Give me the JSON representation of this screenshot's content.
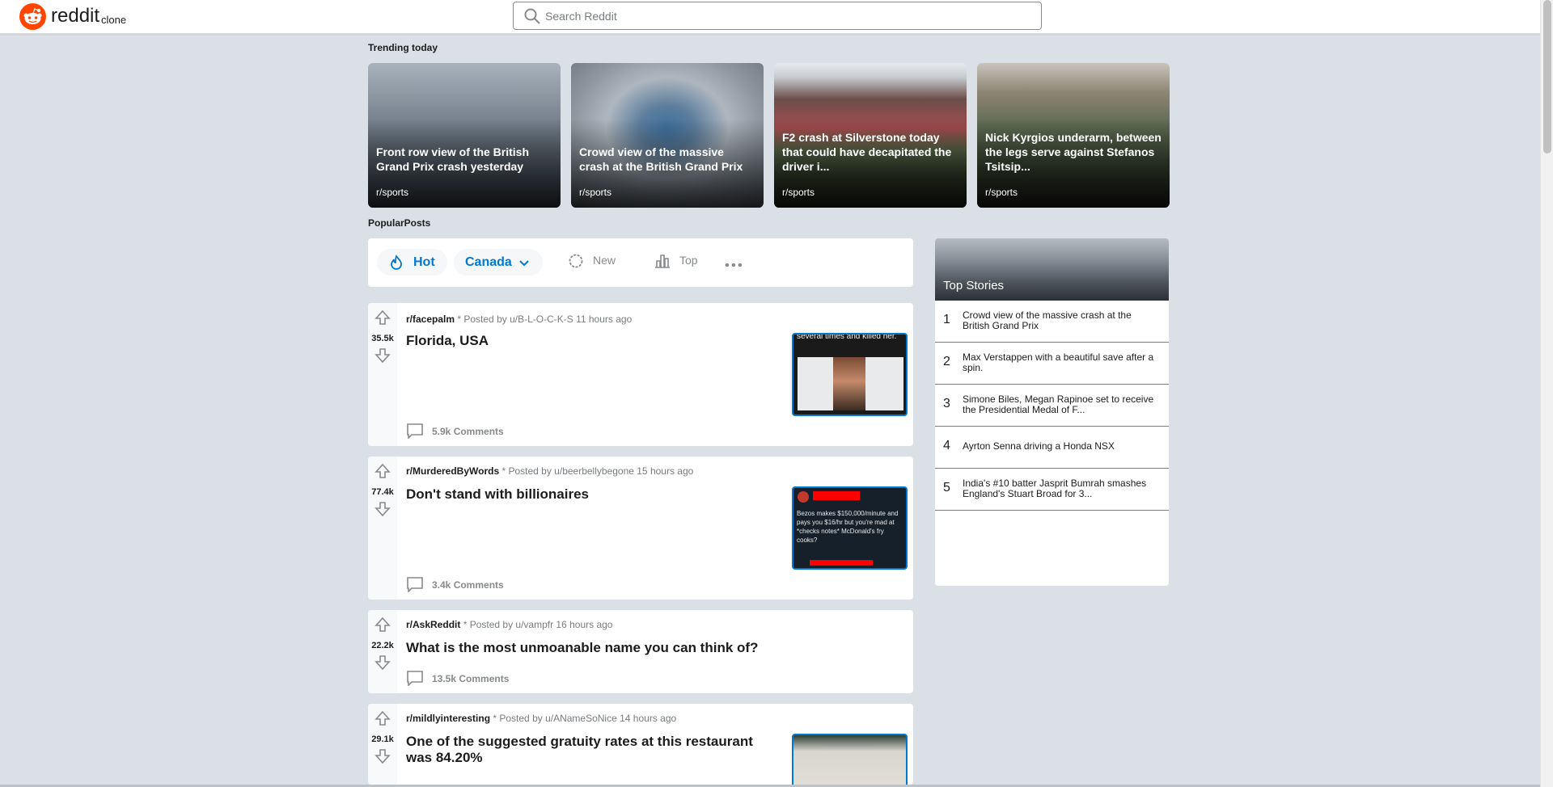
{
  "header": {
    "brand": "reddit",
    "brand_sub": "clone",
    "search_placeholder": "Search Reddit"
  },
  "trending": {
    "heading": "Trending today",
    "cards": [
      {
        "title": "Front row view of the British Grand Prix crash yesterday",
        "subreddit": "r/sports"
      },
      {
        "title": "Crowd view of the massive crash at the British Grand Prix",
        "subreddit": "r/sports"
      },
      {
        "title": "F2 crash at Silverstone today that could have decapitated the driver i...",
        "subreddit": "r/sports"
      },
      {
        "title": "Nick Kyrgios underarm, between the legs serve against Stefanos Tsitsip...",
        "subreddit": "r/sports"
      }
    ]
  },
  "popular": {
    "heading": "PopularPosts",
    "filters": {
      "hot": "Hot",
      "region": "Canada",
      "new": "New",
      "top": "Top"
    }
  },
  "posts": [
    {
      "subreddit": "r/facepalm",
      "posted_by": " * Posted by u/B-L-O-C-K-S 11 hours ago",
      "votes": "35.5k",
      "title": "Florida, USA",
      "comments": "5.9k Comments",
      "thumb_text": "several times and killed her."
    },
    {
      "subreddit": "r/MurderedByWords",
      "posted_by": " * Posted by u/beerbellybegone 15 hours ago",
      "votes": "77.4k",
      "title": "Don't stand with billionaires",
      "comments": "3.4k Comments",
      "thumb_text": "Bezos makes $150,000/minute and pays you $16/hr but you're mad at *checks notes* McDonald's fry cooks?"
    },
    {
      "subreddit": "r/AskReddit",
      "posted_by": " * Posted by u/vampfr 16 hours ago",
      "votes": "22.2k",
      "title": "What is the most unmoanable name you can think of?",
      "comments": "13.5k Comments"
    },
    {
      "subreddit": "r/mildlyinteresting",
      "posted_by": " * Posted by u/ANameSoNice 14 hours ago",
      "votes": "29.1k",
      "title": "One of the suggested gratuity rates at this restaurant was 84.20%"
    }
  ],
  "top_stories": {
    "heading": "Top Stories",
    "items": [
      {
        "num": "1",
        "text": "Crowd view of the massive crash at the British Grand Prix"
      },
      {
        "num": "2",
        "text": "Max Verstappen with a beautiful save after a spin."
      },
      {
        "num": "3",
        "text": "Simone Biles, Megan Rapinoe set to receive the Presidential Medal of F..."
      },
      {
        "num": "4",
        "text": "Ayrton Senna driving a Honda NSX"
      },
      {
        "num": "5",
        "text": "India's #10 batter Jasprit Bumrah smashes England's Stuart Broad for 3..."
      }
    ]
  },
  "colors": {
    "accent": "#0079d3",
    "brand": "#ff4500",
    "background": "#dae0e6"
  },
  "icons": [
    "reddit-logo-icon",
    "search-icon",
    "flame-icon",
    "chevron-down-icon",
    "new-icon",
    "bar-chart-icon",
    "more-icon",
    "upvote-icon",
    "downvote-icon",
    "comment-icon"
  ]
}
